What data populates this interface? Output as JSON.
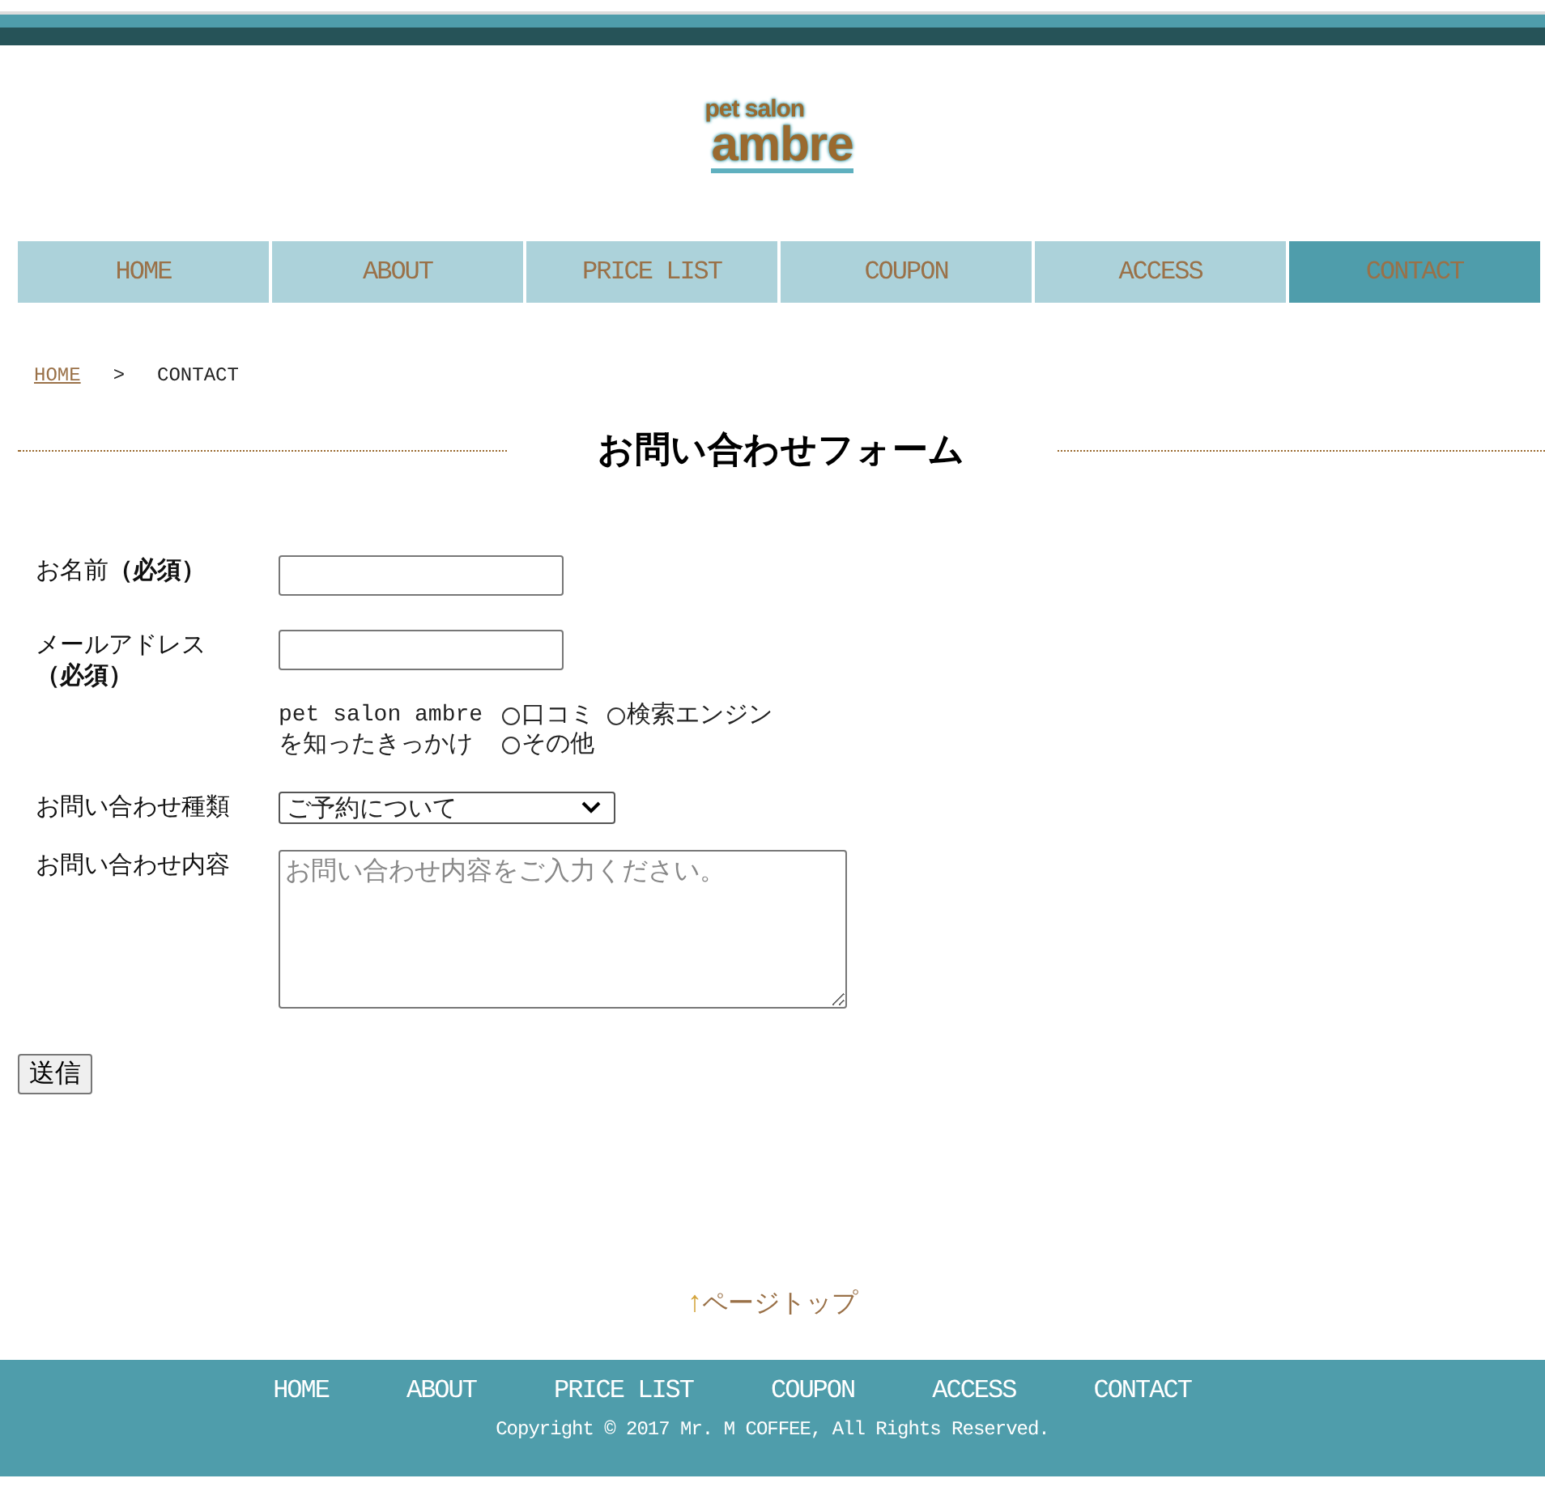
{
  "logo": {
    "small": "pet salon",
    "large": "ambre"
  },
  "nav": [
    {
      "label": "HOME",
      "selected": false
    },
    {
      "label": "ABOUT",
      "selected": false
    },
    {
      "label": "PRICE LIST",
      "selected": false
    },
    {
      "label": "COUPON",
      "selected": false
    },
    {
      "label": "ACCESS",
      "selected": false
    },
    {
      "label": "CONTACT",
      "selected": true
    }
  ],
  "breadcrumb": {
    "link": "HOME",
    "separator": ">",
    "current": "CONTACT"
  },
  "heading": "お問い合わせフォーム",
  "form": {
    "name_label": "お名前**（必須）**",
    "email_label": "メールアドレス**（必須）**",
    "source_label_1": "pet salon ambre",
    "source_label_2": "を知ったきっかけ",
    "source_options": [
      {
        "label": "口コミ",
        "checked": false
      },
      {
        "label": "検索エンジン",
        "checked": false
      },
      {
        "label": "その他",
        "checked": false
      }
    ],
    "type_label": "お問い合わせ種類",
    "type_value": "ご予約について",
    "content_label": "お問い合わせ内容",
    "content_placeholder": "お問い合わせ内容をご入力ください。",
    "submit": "送信"
  },
  "page_top": {
    "arrow": "↑",
    "label": "ページトップ"
  },
  "footer": {
    "nav": [
      "HOME",
      "ABOUT",
      "PRICE LIST",
      "COUPON",
      "ACCESS",
      "CONTACT"
    ],
    "copyright": "Copyright © 2017 Mr. M COFFEE, All Rights Reserved."
  }
}
